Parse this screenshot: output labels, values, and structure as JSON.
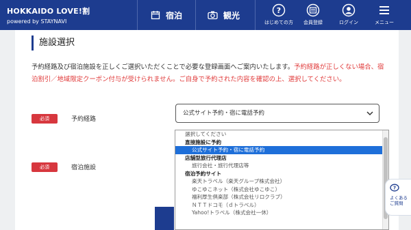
{
  "header": {
    "brand_title": "HOKKAIDO LOVE!割",
    "brand_sub": "powered by STAYNAVI",
    "nav": [
      {
        "label": "宿泊",
        "icon": "calendar-icon"
      },
      {
        "label": "観光",
        "icon": "camera-icon"
      }
    ],
    "right_nav": [
      {
        "label": "はじめての方",
        "icon": "question-icon"
      },
      {
        "label": "会員登録",
        "icon": "register-icon"
      },
      {
        "label": "ログイン",
        "icon": "user-icon"
      },
      {
        "label": "メニュー",
        "icon": "menu-icon"
      }
    ]
  },
  "section": {
    "title": "施設選択",
    "desc_normal": "予約経路及び宿泊施設を正しくご選択いただくことで必要な登録画面へご案内いたします。",
    "desc_red": "予約経路が正しくない場合、宿泊割引／地域限定クーポン付与が受けられません。ご自身で予約された内容を確認の上、選択してください。"
  },
  "fields": {
    "required_label": "必須",
    "route_label": "予約経路",
    "facility_label": "宿泊施設",
    "route_selected": "公式サイト予約・宿に電話予約"
  },
  "dropdown": {
    "placeholder": "選択してください",
    "group1": "直接施設に予約",
    "g1_opt1": "公式サイト予約・宿に電話予約",
    "group2": "店舗型旅行代理店",
    "g2_opt1": "旅行会社・旅行代理店等",
    "group3": "宿泊予約サイト",
    "g3_opt1": "楽天トラベル（楽天グループ株式会社）",
    "g3_opt2": "ゆこゆこネット（株式会社ゆこゆこ）",
    "g3_opt3": "福利厚生倶楽部（株式会社リロクラブ）",
    "g3_opt4": "ＮＴＴドコモ（ｄトラベル）",
    "g3_opt5": "Yahoo!トラベル（株式会社一休）"
  },
  "faq": {
    "line1": "よくある",
    "line2": "ご質問"
  },
  "colors": {
    "brand": "#1d3c8f",
    "required": "#d7373e",
    "warning": "#e03a3a",
    "selected": "#1e6fd9"
  }
}
